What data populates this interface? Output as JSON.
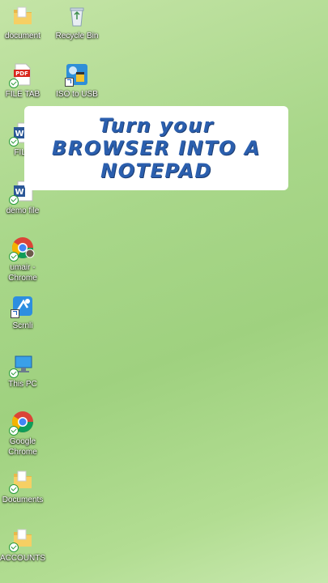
{
  "banner": {
    "text": "Turn your BROWSER INTO A NOTEPAD"
  },
  "icons": {
    "document": {
      "label": "document",
      "icon": "folder-icon"
    },
    "recycle_bin": {
      "label": "Recycle Bin",
      "icon": "recycle-bin-icon"
    },
    "file_tab": {
      "label": "FILE TAB",
      "icon": "pdf-file-icon"
    },
    "iso_to_usb": {
      "label": "ISO to USB",
      "icon": "iso-to-usb-icon"
    },
    "file": {
      "label": "FILE",
      "icon": "word-document-icon"
    },
    "demo_file": {
      "label": "demo file",
      "icon": "word-document-icon"
    },
    "umair_chrome": {
      "label": "umair - Chrome",
      "icon": "chrome-profile-icon"
    },
    "scrnli": {
      "label": "Scrnli",
      "icon": "scrnli-icon"
    },
    "this_pc": {
      "label": "This PC",
      "icon": "computer-icon"
    },
    "google_chrome": {
      "label": "Google Chrome",
      "icon": "chrome-icon"
    },
    "documents": {
      "label": "Documents",
      "icon": "folder-icon"
    },
    "accounts": {
      "label": "ACCOUNTS",
      "icon": "folder-icon"
    }
  },
  "colors": {
    "banner_text": "#2b5fae",
    "banner_bg": "#ffffff",
    "desktop_bg": "#a9d78a"
  }
}
